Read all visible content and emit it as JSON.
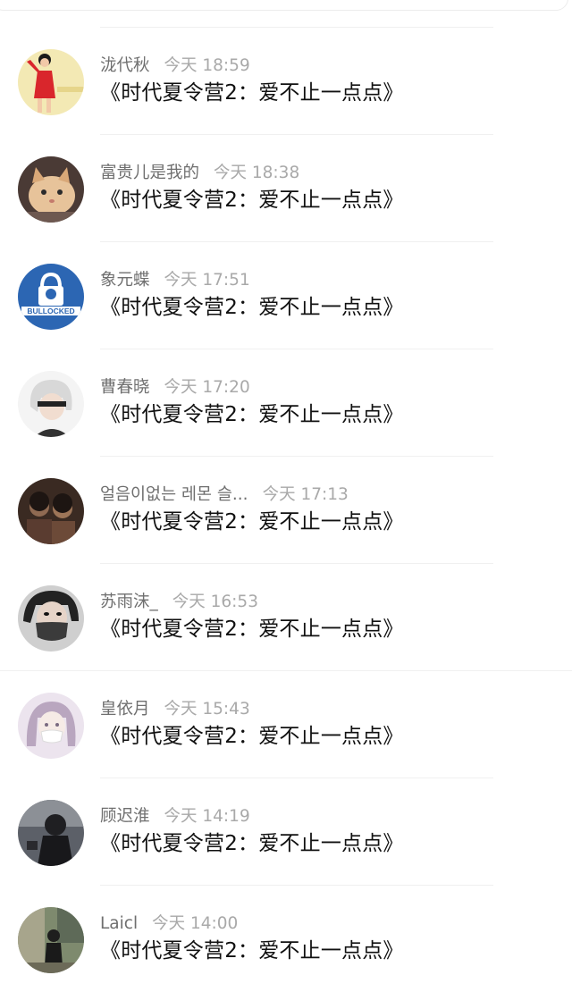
{
  "comments": [
    {
      "name": "泷代秋",
      "time": "今天 18:59",
      "text": "《时代夏令营2：爱不止一点点》",
      "avatar": "avatar-girl-red"
    },
    {
      "name": "富贵儿是我的",
      "time": "今天 18:38",
      "text": "《时代夏令营2：爱不止一点点》",
      "avatar": "avatar-cat"
    },
    {
      "name": "象元蝶",
      "time": "今天 17:51",
      "text": "《时代夏令营2：爱不止一点点》",
      "avatar": "avatar-bullocked-logo",
      "avatar_text": "BULLOCKED"
    },
    {
      "name": "曹春晓",
      "time": "今天 17:20",
      "text": "《时代夏令营2：爱不止一点点》",
      "avatar": "avatar-anime-white-hair"
    },
    {
      "name": "얼음이없는 레몬 슬...",
      "time": "今天 17:13",
      "text": "《时代夏令营2：爱不止一点点》",
      "avatar": "avatar-two-people"
    },
    {
      "name": "苏雨沫_",
      "time": "今天 16:53",
      "text": "《时代夏令营2：爱不止一点点》",
      "avatar": "avatar-masked-person"
    },
    {
      "name": "皇依月",
      "time": "今天 15:43",
      "text": "《时代夏令营2：爱不止一点点》",
      "avatar": "avatar-anime-girl-mask"
    },
    {
      "name": "顾迟淮",
      "time": "今天 14:19",
      "text": "《时代夏令营2：爱不止一点点》",
      "avatar": "avatar-dark-photo"
    },
    {
      "name": "Laicl",
      "time": "今天 14:00",
      "text": "《时代夏令营2：爱不止一点点》",
      "avatar": "avatar-street-photo"
    }
  ]
}
